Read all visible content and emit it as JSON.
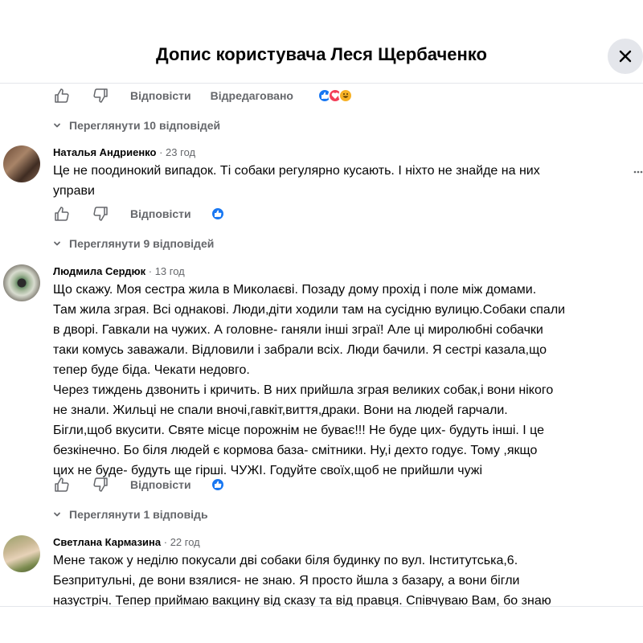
{
  "header": {
    "title": "Допис користувача Леся Щербаченко",
    "close_icon": "close-icon"
  },
  "actions": {
    "reply_label": "Відповісти",
    "edited_label": "Відредаговано"
  },
  "top_block": {
    "reactions": [
      "like",
      "love",
      "haha"
    ],
    "view_replies": "Переглянути 10 відповідей"
  },
  "comments": [
    {
      "author": "Наталья Андриенко",
      "separator": "·",
      "time": "23 год",
      "text": "Це не поодинокий випадок. Ті собаки регулярно кусають. І ніхто не знайде на них\nуправи",
      "reactions": [
        "like"
      ],
      "view_replies": "Переглянути 9 відповідей"
    },
    {
      "author": "Людмила Сердюк",
      "separator": "·",
      "time": "13 год",
      "text": "Що скажу. Моя сестра жила в Миколаєві. Позаду дому прохід і поле між домами.\nТам жила зграя. Всі однакові. Люди,діти ходили там на сусідню вулицю.Собаки спали\nв дворі. Гавкали на чужих. А головне- ганяли інші зграї! Але ці миролюбні собачки\nтаки комусь заважали. Відловили і забрали всіх. Люди бачили. Я сестрі казала,що\nтепер буде біда. Чекати недовго.\nЧерез тиждень дзвонить і кричить. В них прийшла зграя великих собак,і вони нікого\nне знали. Жильці не спали вночі,гавкіт,виття,драки. Вони на людей гарчали.\nБігли,щоб вкусити. Святе місце порожнім не буває!!! Не буде цих- будуть інші. І це\nбезкінечно. Бо біля людей є кормова база- смітники. Ну,і дехто годує. Тому ,якщо\nцих не буде- будуть ще гірші. ЧУЖІ. Годуйте своїх,щоб не прийшли чужі",
      "reactions": [
        "like"
      ],
      "view_replies": "Переглянути 1 відповідь"
    },
    {
      "author": "Светлана Кармазина",
      "separator": "·",
      "time": "22 год",
      "text": "Мене також у неділю покусали дві собаки біля будинку по вул. Інститутська,6.\nБезпритульні, де вони взялися- не знаю. Я просто йшла з базару, а вони бігли\nназустріч. Тепер приймаю вакцину від сказу та від правця. Співчуваю Вам, бо знаю"
    }
  ],
  "colors": {
    "accent": "#1877f2",
    "secondary_text": "#65676b",
    "divider": "#e4e6eb"
  }
}
